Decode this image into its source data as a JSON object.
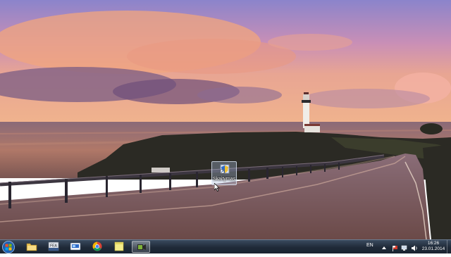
{
  "desktop": {
    "icons": [
      {
        "label": "Skaitymas",
        "icon": "shortcut-shield-icon"
      }
    ]
  },
  "taskbar": {
    "start_icon": "windows-orb-icon",
    "pinned": [
      {
        "icon": "windows-explorer-icon",
        "active": false
      },
      {
        "icon": "fea-app-icon",
        "label": "FEA",
        "active": false
      },
      {
        "icon": "media-center-icon",
        "active": false
      },
      {
        "icon": "chrome-icon",
        "active": false
      },
      {
        "icon": "sticky-notes-icon",
        "active": false
      },
      {
        "icon": "camtasia-recorder-icon",
        "active": true
      }
    ],
    "tray": {
      "language": "EN",
      "icons": [
        "show-hidden-icon",
        "action-center-flag-icon",
        "network-icon",
        "volume-icon"
      ],
      "time": "16:26",
      "date": "23.01.2014"
    }
  },
  "colors": {
    "taskbar": "#1f2a38",
    "sky_top": "#8f86c8",
    "sky_glow": "#f3b08c"
  }
}
